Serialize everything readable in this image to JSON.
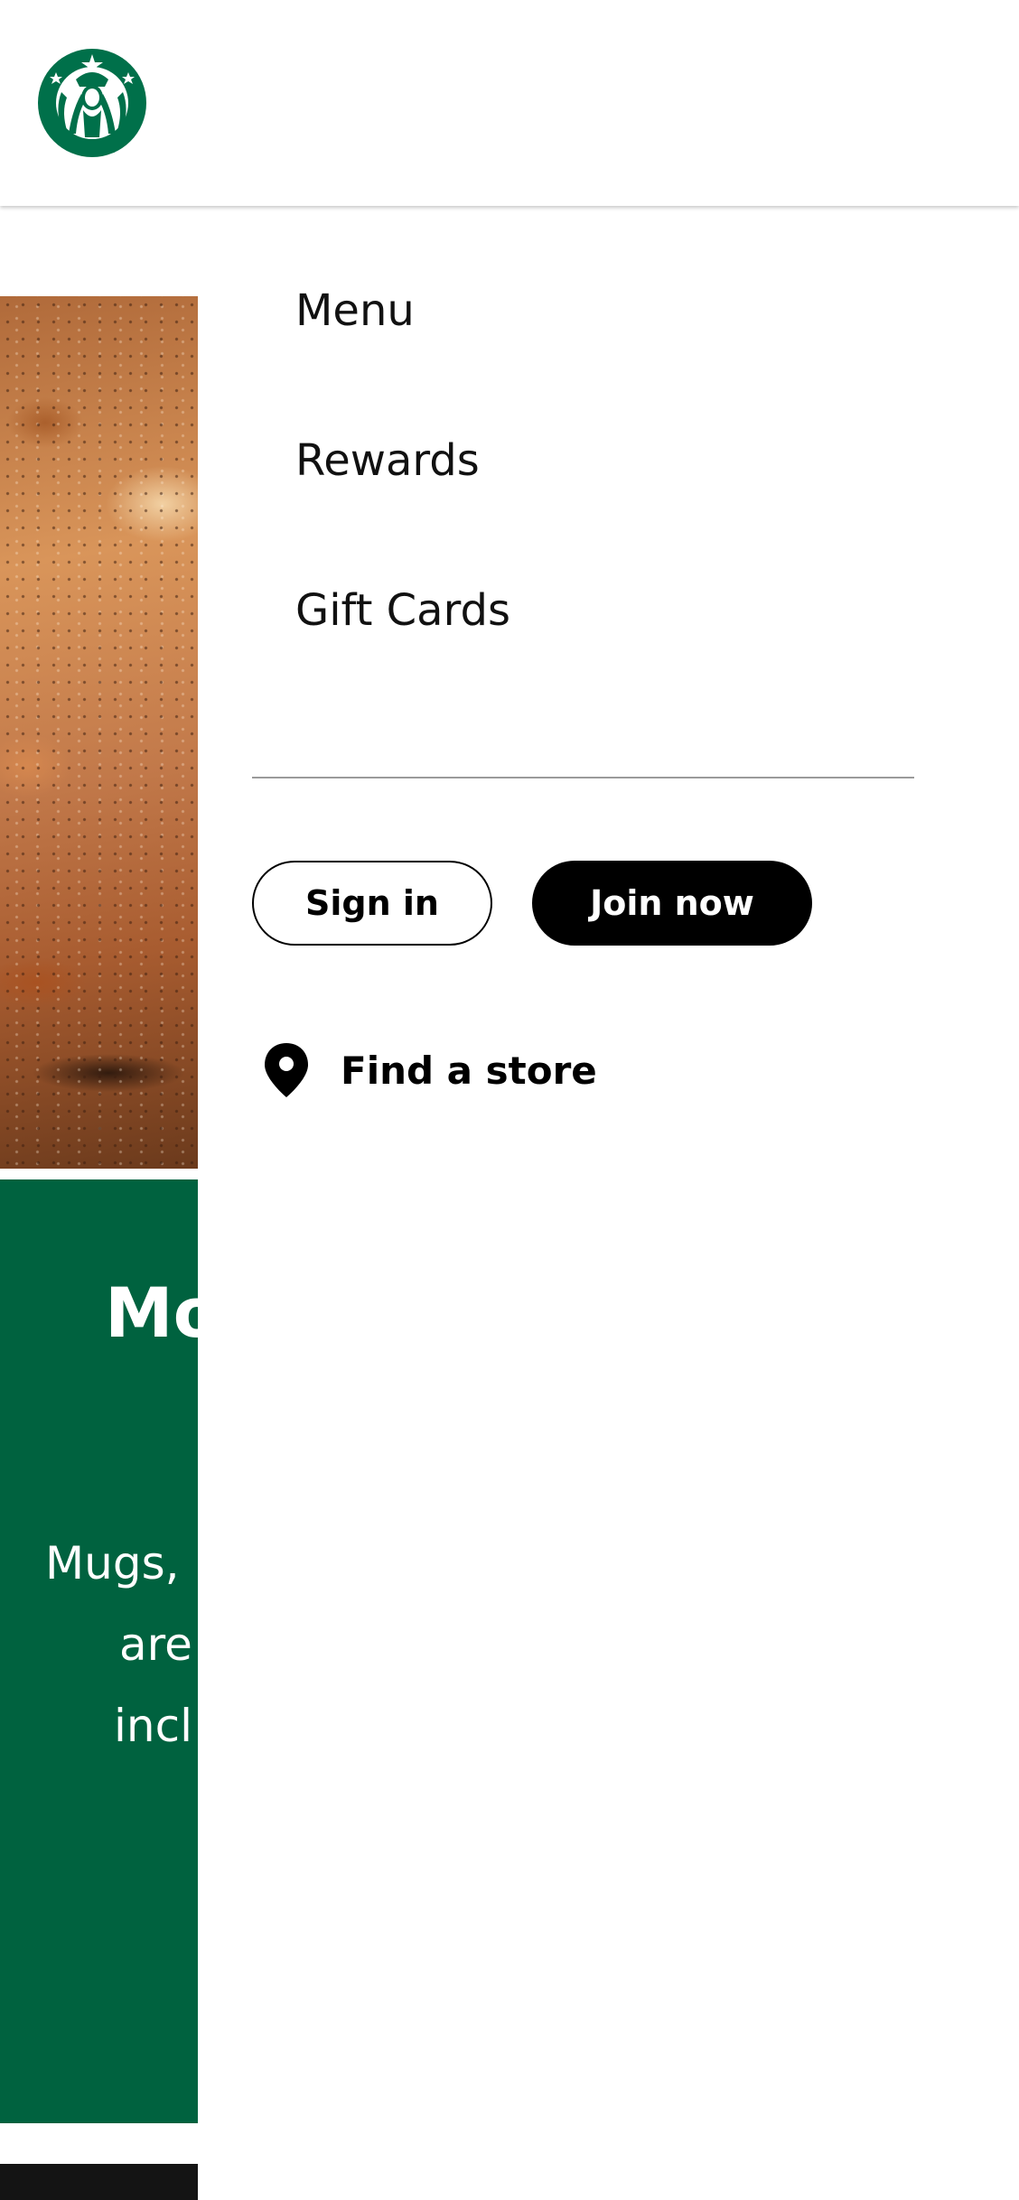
{
  "brand": {
    "logo_icon": "starbucks-siren-logo-icon",
    "logo_color": "#00704A"
  },
  "nav": {
    "items": [
      {
        "label": "Menu"
      },
      {
        "label": "Rewards"
      },
      {
        "label": "Gift Cards"
      }
    ]
  },
  "account": {
    "sign_in_label": "Sign in",
    "join_label": "Join now"
  },
  "store_locator": {
    "label": "Find a store",
    "icon": "location-pin-icon"
  },
  "background_page": {
    "title_fragment": "Mo",
    "body_fragments": [
      "Mugs,",
      "are",
      "incl"
    ],
    "panel_color": "#00623F"
  }
}
